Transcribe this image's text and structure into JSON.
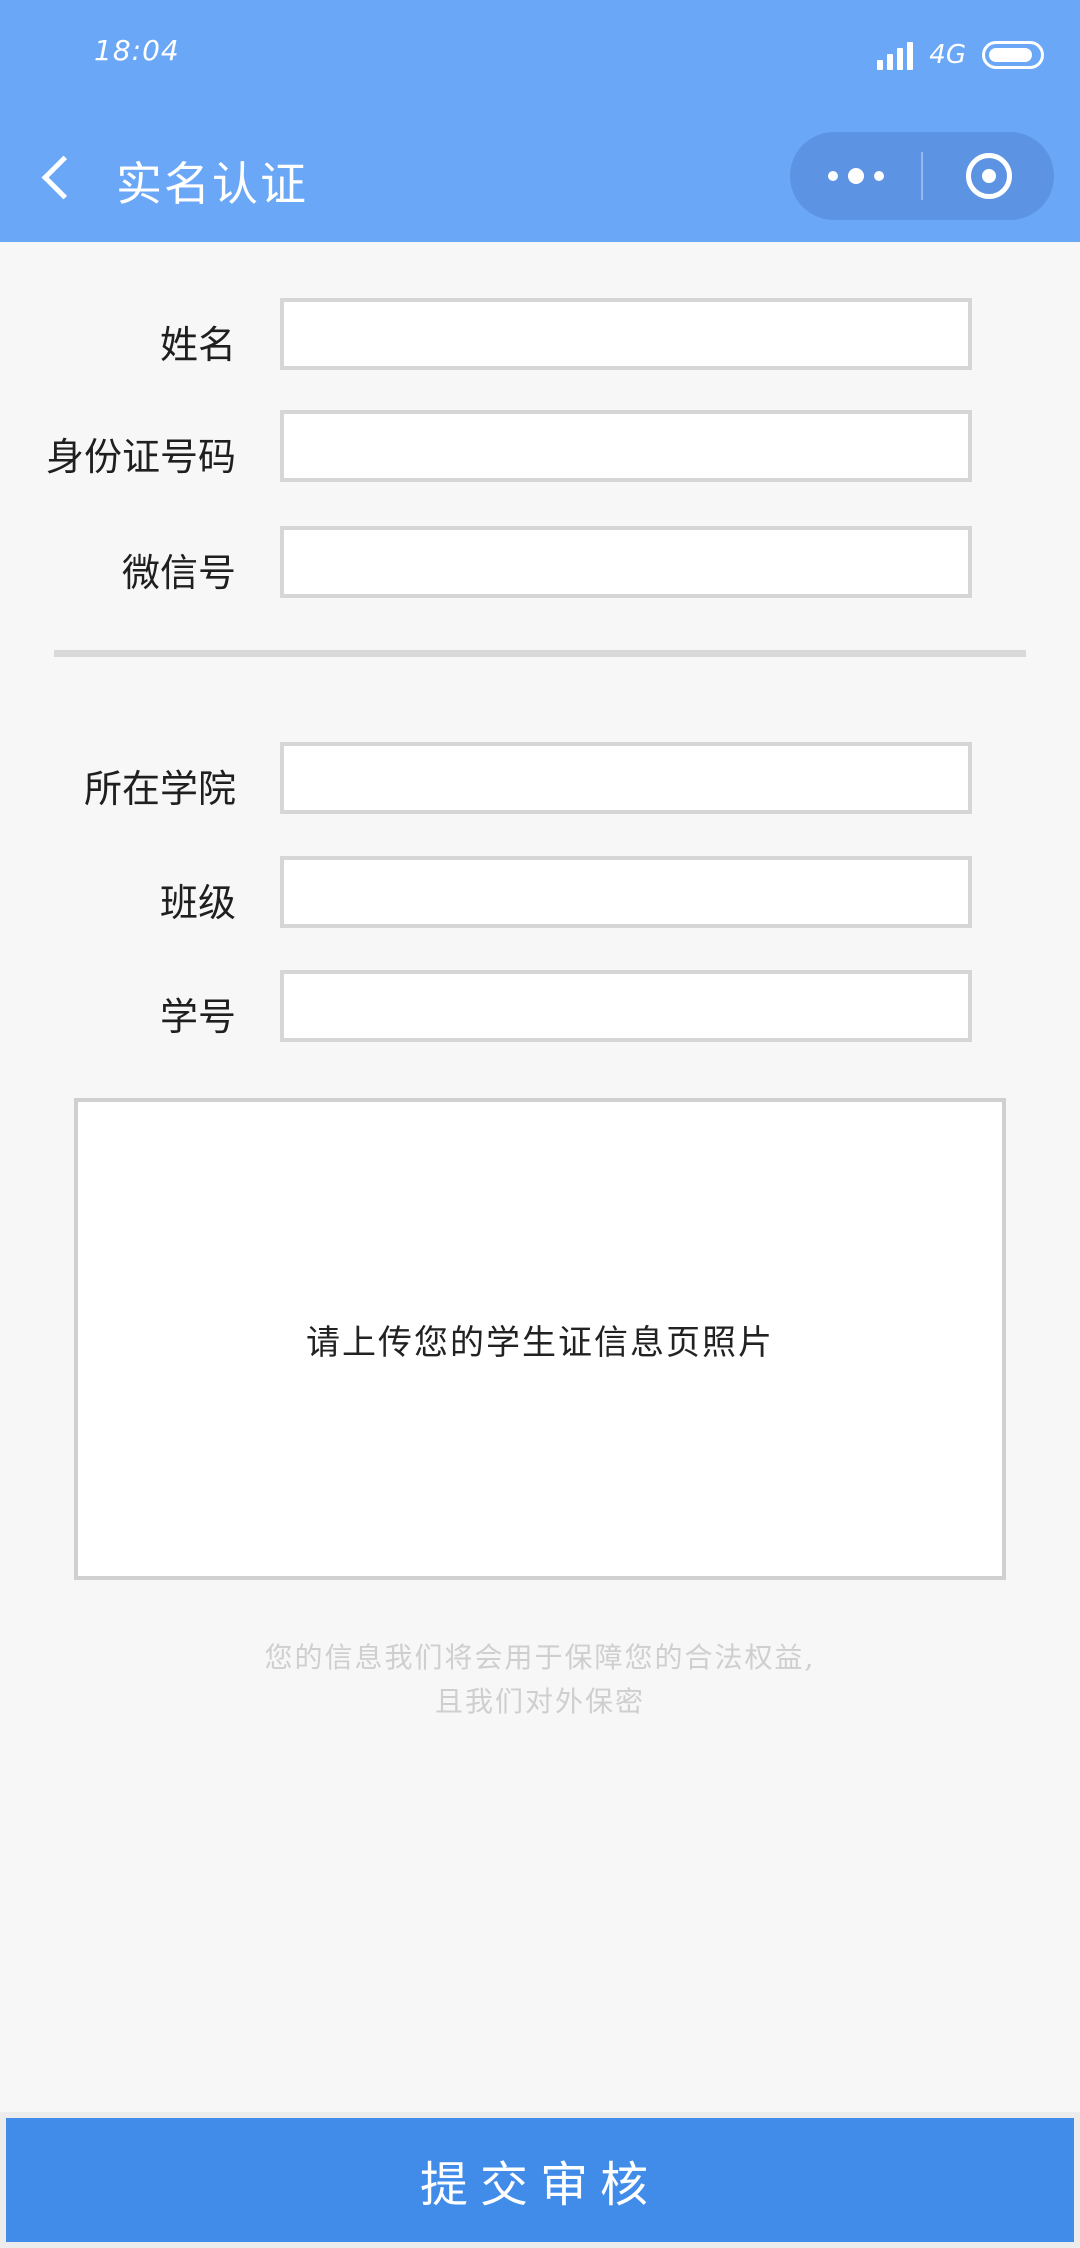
{
  "status_bar": {
    "time": "18:04",
    "network": "4G",
    "battery_level": 0.9
  },
  "header": {
    "title": "实名认证",
    "back_icon": "chevron-left-icon",
    "more_icon": "more-dots-icon",
    "close_icon": "target-icon"
  },
  "form": {
    "personal": [
      {
        "label": "姓名",
        "value": ""
      },
      {
        "label": "身份证号码",
        "value": ""
      },
      {
        "label": "微信号",
        "value": ""
      }
    ],
    "school": [
      {
        "label": "所在学院",
        "value": ""
      },
      {
        "label": "班级",
        "value": ""
      },
      {
        "label": "学号",
        "value": ""
      }
    ]
  },
  "upload": {
    "prompt": "请上传您的学生证信息页照片"
  },
  "privacy": {
    "line1": "您的信息我们将会用于保障您的合法权益,",
    "line2": "且我们对外保密"
  },
  "submit": {
    "label": "提交审核"
  },
  "colors": {
    "header_bg": "#6aa7f6",
    "capsule_bg": "#5d93e3",
    "submit_bg": "#428ce9",
    "page_bg": "#f7f7f7"
  }
}
